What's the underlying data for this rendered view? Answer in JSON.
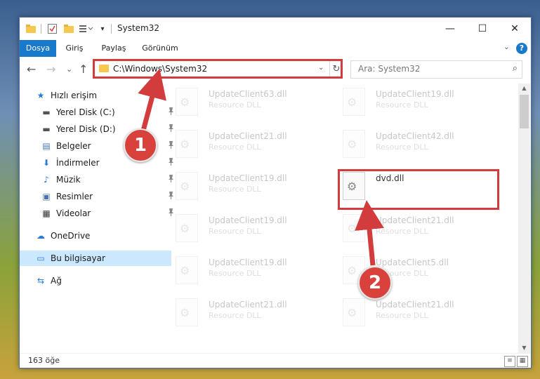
{
  "window": {
    "title": "System32",
    "buttons": {
      "minimize": "—",
      "maximize": "☐",
      "close": "✕"
    },
    "qa_icons": [
      "▭",
      "✔",
      "▭",
      "☰▾",
      "▾"
    ]
  },
  "ribbon": {
    "tabs": [
      {
        "label": "Dosya",
        "active": true
      },
      {
        "label": "Giriş",
        "active": false
      },
      {
        "label": "Paylaş",
        "active": false
      },
      {
        "label": "Görünüm",
        "active": false
      }
    ],
    "help": "?",
    "collapse": "⌄"
  },
  "nav": {
    "back": "←",
    "forward": "→",
    "recent": "⌄",
    "up": "↑",
    "address": "C:\\Windows\\System32",
    "address_dropdown": "⌄",
    "refresh": "↻",
    "search_placeholder": "Ara: System32",
    "search_icon": "⌕"
  },
  "sidebar": {
    "items": [
      {
        "label": "Hızlı erişim",
        "icon": "★",
        "icon_color": "#2b7cd3",
        "pinned": false
      },
      {
        "label": "Yerel Disk (C:)",
        "icon": "▬",
        "icon_color": "#555",
        "pinned": true
      },
      {
        "label": "Yerel Disk (D:)",
        "icon": "▬",
        "icon_color": "#555",
        "pinned": true
      },
      {
        "label": "Belgeler",
        "icon": "▤",
        "icon_color": "#4a72b2",
        "pinned": true
      },
      {
        "label": "İndirmeler",
        "icon": "⬇",
        "icon_color": "#2b7cd3",
        "pinned": true
      },
      {
        "label": "Müzik",
        "icon": "♪",
        "icon_color": "#2b7cd3",
        "pinned": true
      },
      {
        "label": "Resimler",
        "icon": "▣",
        "icon_color": "#4a72b2",
        "pinned": true
      },
      {
        "label": "Videolar",
        "icon": "▦",
        "icon_color": "#333",
        "pinned": true
      },
      {
        "label": "OneDrive",
        "icon": "☁",
        "icon_color": "#2b7cd3",
        "pinned": false
      },
      {
        "label": "Bu bilgisayar",
        "icon": "▭",
        "icon_color": "#2b7cd3",
        "pinned": false,
        "selected": true
      },
      {
        "label": "Ağ",
        "icon": "⇆",
        "icon_color": "#2b7cd3",
        "pinned": false
      }
    ],
    "pin_icon": "📌"
  },
  "files": [
    {
      "name": "UpdateClient63.dll",
      "desc": "Resource DLL",
      "faded": true
    },
    {
      "name": "UpdateClient19.dll",
      "desc": "Resource DLL",
      "faded": true
    },
    {
      "name": "UpdateClient21.dll",
      "desc": "Resource DLL",
      "faded": true
    },
    {
      "name": "UpdateClient42.dll",
      "desc": "Resource DLL",
      "faded": true
    },
    {
      "name": "UpdateClient19.dll",
      "desc": "Resource DLL",
      "faded": true
    },
    {
      "name": "dvd.dll",
      "desc": "",
      "faded": false
    },
    {
      "name": "UpdateClient19.dll",
      "desc": "Resource DLL",
      "faded": true
    },
    {
      "name": "UpdateClient21.dll",
      "desc": "Resource DLL",
      "faded": true
    },
    {
      "name": "UpdateClient19.dll",
      "desc": "Resource DLL",
      "faded": true
    },
    {
      "name": "UpdateClient5.dll",
      "desc": "Resource DLL",
      "faded": true
    },
    {
      "name": "UpdateClient21.dll",
      "desc": "Resource DLL",
      "faded": true
    },
    {
      "name": "UpdateClient21.dll",
      "desc": "Resource DLL",
      "faded": true
    }
  ],
  "status": {
    "count": "163 öğe",
    "view_details": "≡",
    "view_icons": "▦"
  },
  "annotations": {
    "badge1": "1",
    "badge2": "2",
    "color": "#d23c3c"
  }
}
